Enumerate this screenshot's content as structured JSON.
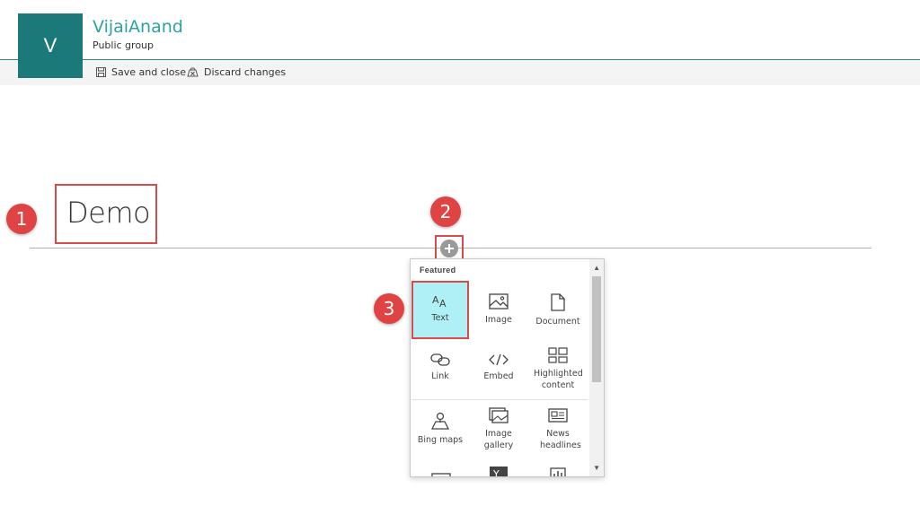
{
  "header": {
    "logo_letter": "V",
    "site_title": "VijaiAnand",
    "site_subtitle": "Public group",
    "accent": "#1b7a79"
  },
  "toolbar": {
    "save_label": "Save and close",
    "save_icon": "save-icon",
    "discard_label": "Discard changes",
    "discard_icon": "discard-icon"
  },
  "page": {
    "title": "Demo"
  },
  "steps": [
    "1",
    "2",
    "3"
  ],
  "toolbox": {
    "section_label": "Featured",
    "items": [
      {
        "label": "Text",
        "icon": "text-icon",
        "selected": true
      },
      {
        "label": "Image",
        "icon": "image-icon"
      },
      {
        "label": "Document",
        "icon": "document-icon"
      },
      {
        "label": "Link",
        "icon": "link-icon"
      },
      {
        "label": "Embed",
        "icon": "embed-icon"
      },
      {
        "label": "Highlighted content",
        "icon": "highlighted-content-icon"
      },
      {
        "label": "Bing maps",
        "icon": "bing-maps-icon"
      },
      {
        "label": "Image gallery",
        "icon": "image-gallery-icon"
      },
      {
        "label": "News headlines",
        "icon": "news-headlines-icon"
      }
    ]
  },
  "colors": {
    "step_badge": "#e04343",
    "highlight_border": "#d94a4a",
    "selected_tile": "#aef0f5"
  }
}
